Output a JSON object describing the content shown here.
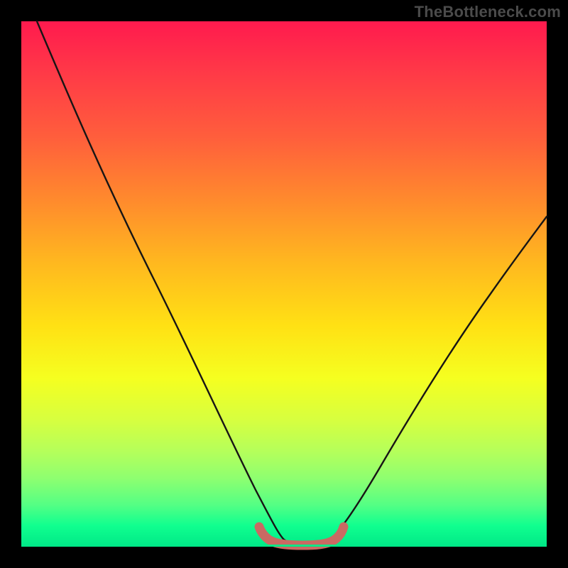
{
  "watermark": "TheBottleneck.com",
  "colors": {
    "frame": "#000000",
    "gradient_top": "#ff1a4e",
    "gradient_mid": "#ffe114",
    "gradient_bottom": "#00e887",
    "curve_stroke": "#171515",
    "baseline_marker": "#c96a63"
  },
  "chart_data": {
    "type": "line",
    "title": "",
    "xlabel": "",
    "ylabel": "",
    "xlim": [
      0,
      100
    ],
    "ylim": [
      0,
      100
    ],
    "series": [
      {
        "name": "bottleneck-curve",
        "x": [
          3,
          10,
          20,
          30,
          40,
          45,
          48,
          50,
          53,
          55,
          57,
          60,
          65,
          75,
          85,
          100
        ],
        "y_guess": [
          100,
          86,
          70,
          52,
          33,
          18,
          7,
          2,
          0,
          0,
          0,
          2,
          8,
          22,
          36,
          55
        ]
      }
    ],
    "annotations": [
      {
        "name": "baseline-marker",
        "x_start": 45,
        "x_end": 61,
        "y": 0
      }
    ],
    "legend": false,
    "grid": false,
    "axes_visible": false
  }
}
